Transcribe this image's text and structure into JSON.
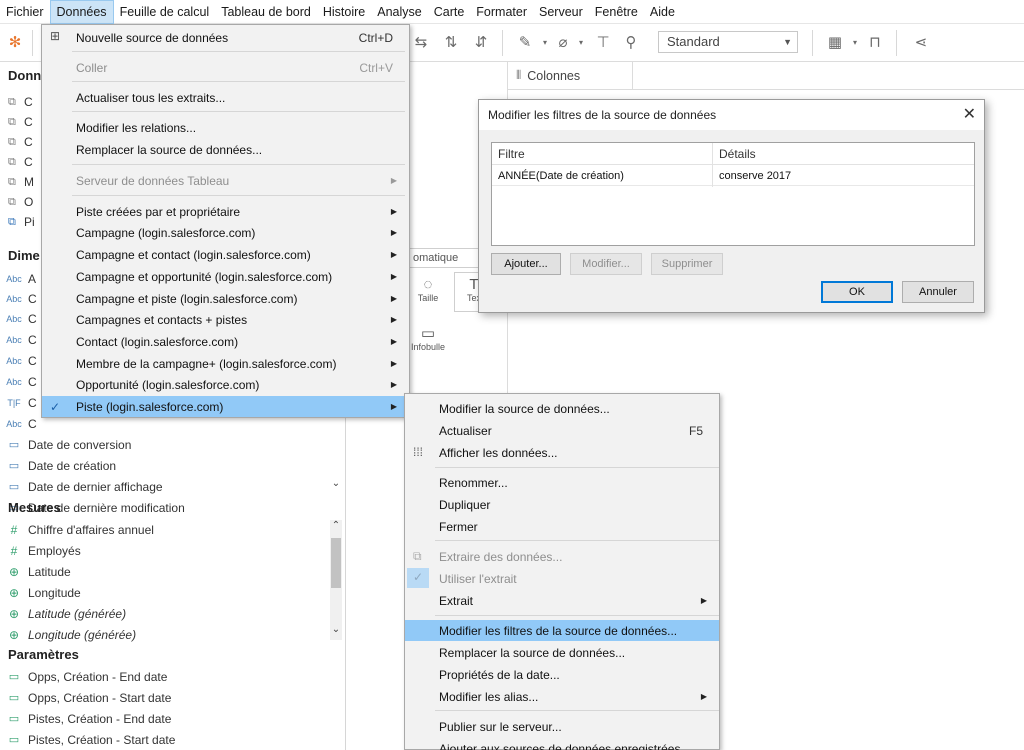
{
  "menubar": {
    "items": [
      "Fichier",
      "Données",
      "Feuille de calcul",
      "Tableau de bord",
      "Histoire",
      "Analyse",
      "Carte",
      "Formater",
      "Serveur",
      "Fenêtre",
      "Aide"
    ]
  },
  "toolbar": {
    "fit_value": "Standard"
  },
  "data_pane": {
    "title": "Donn",
    "datasources": [
      "C",
      "C",
      "C",
      "C",
      "M",
      "O",
      "Pi"
    ],
    "dimensions_title": "Dime",
    "dimension_fields": [
      {
        "type": "Abc",
        "label": "A"
      },
      {
        "type": "Abc",
        "label": "C"
      },
      {
        "type": "Abc",
        "label": "C"
      },
      {
        "type": "Abc",
        "label": "C"
      },
      {
        "type": "Abc",
        "label": "C"
      },
      {
        "type": "Abc",
        "label": "C"
      },
      {
        "type": "T|F",
        "label": "C"
      },
      {
        "type": "Abc",
        "label": "C"
      },
      {
        "type": "date",
        "label": "Date de conversion"
      },
      {
        "type": "date",
        "label": "Date de création"
      },
      {
        "type": "datetime",
        "label": "Date de dernier affichage"
      },
      {
        "type": "datetime",
        "label": "Date de dernière modification"
      }
    ],
    "measures_title": "Mesures",
    "measure_fields": [
      {
        "type": "#",
        "label": "Chiffre d'affaires annuel",
        "italic": false
      },
      {
        "type": "#",
        "label": "Employés",
        "italic": false
      },
      {
        "type": "geo",
        "label": "Latitude",
        "italic": false
      },
      {
        "type": "geo",
        "label": "Longitude",
        "italic": false
      },
      {
        "type": "geo",
        "label": "Latitude (générée)",
        "italic": true
      },
      {
        "type": "geo",
        "label": "Longitude (générée)",
        "italic": true
      }
    ],
    "parameters_title": "Paramètres",
    "parameter_fields": [
      "Opps, Création - End date",
      "Opps, Création - Start date",
      "Pistes, Création - End date",
      "Pistes, Création - Start date"
    ]
  },
  "marks_card": {
    "type_value": "omatique",
    "buttons": [
      "Taille",
      "Tex",
      "Infobulle"
    ]
  },
  "shelves": {
    "columns_label": "Colonnes"
  },
  "data_menu": {
    "items": [
      {
        "label": "Nouvelle source de données",
        "shortcut": "Ctrl+D",
        "state": "normal",
        "submenu": false
      },
      {
        "label": "Coller",
        "shortcut": "Ctrl+V",
        "state": "disabled",
        "submenu": false
      },
      {
        "label": "Actualiser tous les extraits...",
        "shortcut": "",
        "state": "normal",
        "submenu": false
      },
      {
        "label": "Modifier les relations...",
        "shortcut": "",
        "state": "normal",
        "submenu": false
      },
      {
        "label": "Remplacer la source de données...",
        "shortcut": "",
        "state": "normal",
        "submenu": false
      },
      {
        "label": "Serveur de données Tableau",
        "shortcut": "",
        "state": "disabled",
        "submenu": true
      },
      {
        "label": " Piste créées par et propriétaire",
        "shortcut": "",
        "state": "normal",
        "submenu": true
      },
      {
        "label": "Campagne (login.salesforce.com)",
        "shortcut": "",
        "state": "normal",
        "submenu": true
      },
      {
        "label": "Campagne et contact (login.salesforce.com)",
        "shortcut": "",
        "state": "normal",
        "submenu": true
      },
      {
        "label": "Campagne et opportunité (login.salesforce.com)",
        "shortcut": "",
        "state": "normal",
        "submenu": true
      },
      {
        "label": "Campagne et piste (login.salesforce.com)",
        "shortcut": "",
        "state": "normal",
        "submenu": true
      },
      {
        "label": "Campagnes et contacts + pistes",
        "shortcut": "",
        "state": "normal",
        "submenu": true
      },
      {
        "label": "Contact (login.salesforce.com)",
        "shortcut": "",
        "state": "normal",
        "submenu": true
      },
      {
        "label": "Membre de la campagne+ (login.salesforce.com)",
        "shortcut": "",
        "state": "normal",
        "submenu": true
      },
      {
        "label": "Opportunité (login.salesforce.com)",
        "shortcut": "",
        "state": "normal",
        "submenu": true
      },
      {
        "label": "Piste (login.salesforce.com)",
        "shortcut": "",
        "state": "highlighted",
        "submenu": true
      }
    ]
  },
  "sub_menu": {
    "items": [
      {
        "label": "Modifier la source de données...",
        "shortcut": "",
        "state": "normal",
        "submenu": false
      },
      {
        "label": "Actualiser",
        "shortcut": "F5",
        "state": "normal",
        "submenu": false
      },
      {
        "label": "Afficher les données...",
        "shortcut": "",
        "state": "normal",
        "submenu": false
      },
      {
        "label": "Renommer...",
        "shortcut": "",
        "state": "normal",
        "submenu": false
      },
      {
        "label": "Dupliquer",
        "shortcut": "",
        "state": "normal",
        "submenu": false
      },
      {
        "label": "Fermer",
        "shortcut": "",
        "state": "normal",
        "submenu": false
      },
      {
        "label": "Extraire des données...",
        "shortcut": "",
        "state": "disabled",
        "submenu": false
      },
      {
        "label": "Utiliser l'extrait",
        "shortcut": "",
        "state": "disabled",
        "submenu": false
      },
      {
        "label": "Extrait",
        "shortcut": "",
        "state": "normal",
        "submenu": true
      },
      {
        "label": "Modifier les filtres de la source de données...",
        "shortcut": "",
        "state": "highlighted",
        "submenu": false
      },
      {
        "label": "Remplacer la source de données...",
        "shortcut": "",
        "state": "normal",
        "submenu": false
      },
      {
        "label": "Propriétés de la date...",
        "shortcut": "",
        "state": "normal",
        "submenu": false
      },
      {
        "label": "Modifier les alias...",
        "shortcut": "",
        "state": "normal",
        "submenu": true
      },
      {
        "label": "Publier sur le serveur...",
        "shortcut": "",
        "state": "normal",
        "submenu": false
      },
      {
        "label": "Ajouter aux sources de données enregistrées",
        "shortcut": "",
        "state": "normal",
        "submenu": false
      }
    ]
  },
  "dialog": {
    "title": "Modifier les filtres de la source de données",
    "col_filter": "Filtre",
    "col_details": "Détails",
    "rows": [
      {
        "filter": "ANNÉE(Date de création)",
        "details": "conserve 2017"
      }
    ],
    "add_label": "Ajouter...",
    "edit_label": "Modifier...",
    "delete_label": "Supprimer",
    "ok_label": "OK",
    "cancel_label": "Annuler"
  },
  "colors": {
    "highlight": "#91c9f7",
    "menu_bg": "#f2f2f2",
    "accent": "#0078d7"
  }
}
